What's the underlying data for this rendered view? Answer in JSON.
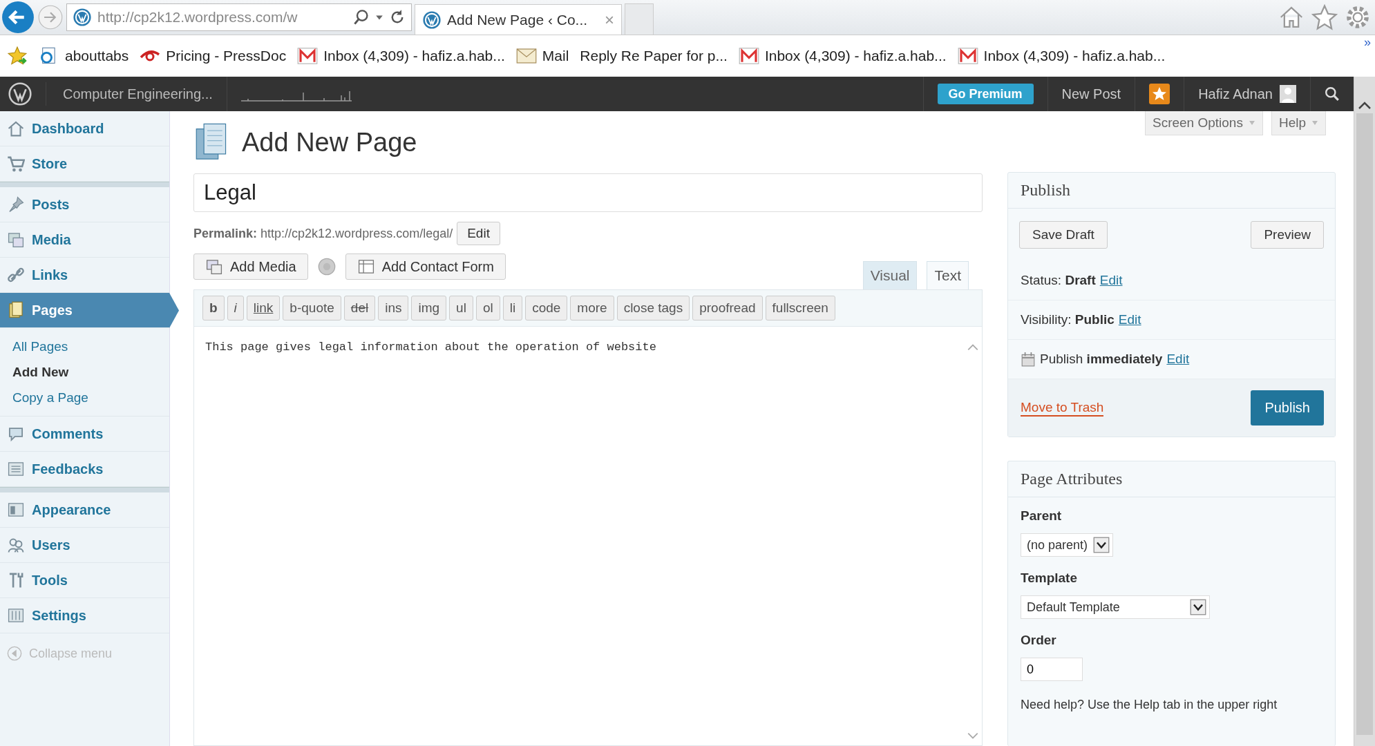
{
  "browser": {
    "address": "http://cp2k12.wordpress.com/w",
    "tab_title": "Add New Page ‹ Co...",
    "tab_close": "×"
  },
  "favorites": [
    {
      "label": "abouttabs",
      "kind": "page"
    },
    {
      "label": "Pricing - PressDoc",
      "kind": "swoosh"
    },
    {
      "label": "Inbox (4,309) - hafiz.a.hab...",
      "kind": "gmail"
    },
    {
      "label": "Mail",
      "kind": "envelope"
    },
    {
      "label": "Reply Re Paper for p...",
      "kind": "none"
    },
    {
      "label": "Inbox (4,309) - hafiz.a.hab...",
      "kind": "gmail"
    },
    {
      "label": "Inbox (4,309) - hafiz.a.hab...",
      "kind": "gmail"
    }
  ],
  "favorites_more": "»",
  "admin_bar": {
    "site": "Computer Engineering...",
    "go_premium": "Go Premium",
    "new_post": "New Post",
    "user": "Hafiz Adnan"
  },
  "screen_options": "Screen Options",
  "help": "Help",
  "sidebar": {
    "groups": [
      [
        {
          "label": "Dashboard",
          "selected": false
        },
        {
          "label": "Store",
          "selected": false
        }
      ],
      [
        {
          "label": "Posts",
          "selected": false
        },
        {
          "label": "Media",
          "selected": false
        },
        {
          "label": "Links",
          "selected": false
        },
        {
          "label": "Pages",
          "selected": true,
          "children": [
            {
              "label": "All Pages",
              "selected": false
            },
            {
              "label": "Add New",
              "selected": true
            },
            {
              "label": "Copy a Page",
              "selected": false
            }
          ]
        },
        {
          "label": "Comments",
          "selected": false
        },
        {
          "label": "Feedbacks",
          "selected": false
        }
      ],
      [
        {
          "label": "Appearance",
          "selected": false
        },
        {
          "label": "Users",
          "selected": false
        },
        {
          "label": "Tools",
          "selected": false
        },
        {
          "label": "Settings",
          "selected": false
        }
      ]
    ],
    "collapse": "Collapse menu"
  },
  "heading": "Add New Page",
  "title_value": "Legal",
  "permalink": {
    "label": "Permalink:",
    "url": "http://cp2k12.wordpress.com/legal/",
    "edit": "Edit"
  },
  "media_buttons": [
    "Add Media",
    "Add Contact Form"
  ],
  "editor_tabs": [
    {
      "label": "Visual",
      "selected": false
    },
    {
      "label": "Text",
      "selected": true
    }
  ],
  "quicktags": [
    {
      "label": "b",
      "kind": "bold"
    },
    {
      "label": "i",
      "kind": "italic"
    },
    {
      "label": "link",
      "kind": "underline"
    },
    {
      "label": "b-quote",
      "kind": "plain"
    },
    {
      "label": "del",
      "kind": "strike"
    },
    {
      "label": "ins",
      "kind": "plain"
    },
    {
      "label": "img",
      "kind": "plain"
    },
    {
      "label": "ul",
      "kind": "plain"
    },
    {
      "label": "ol",
      "kind": "plain"
    },
    {
      "label": "li",
      "kind": "plain"
    },
    {
      "label": "code",
      "kind": "plain"
    },
    {
      "label": "more",
      "kind": "plain"
    },
    {
      "label": "close tags",
      "kind": "plain"
    },
    {
      "label": "proofread",
      "kind": "plain"
    },
    {
      "label": "fullscreen",
      "kind": "plain"
    }
  ],
  "content": "This page gives legal information about the operation of website",
  "publish": {
    "title": "Publish",
    "save_draft": "Save Draft",
    "preview": "Preview",
    "rows": [
      {
        "text": "Status: **Draft**",
        "link": "Edit",
        "calendar": false
      },
      {
        "text": "Visibility: **Public**",
        "link": "Edit",
        "calendar": false
      },
      {
        "text": "Publish **immediately**",
        "link": "Edit",
        "calendar": true
      }
    ],
    "trash": "Move to Trash",
    "publish": "Publish"
  },
  "page_attributes": {
    "title": "Page Attributes",
    "parent_label": "Parent",
    "parent_value": "(no parent)",
    "template_label": "Template",
    "template_value": "Default Template",
    "order_label": "Order",
    "order_value": "0",
    "help_text": "Need help? Use the Help tab in the upper right"
  }
}
